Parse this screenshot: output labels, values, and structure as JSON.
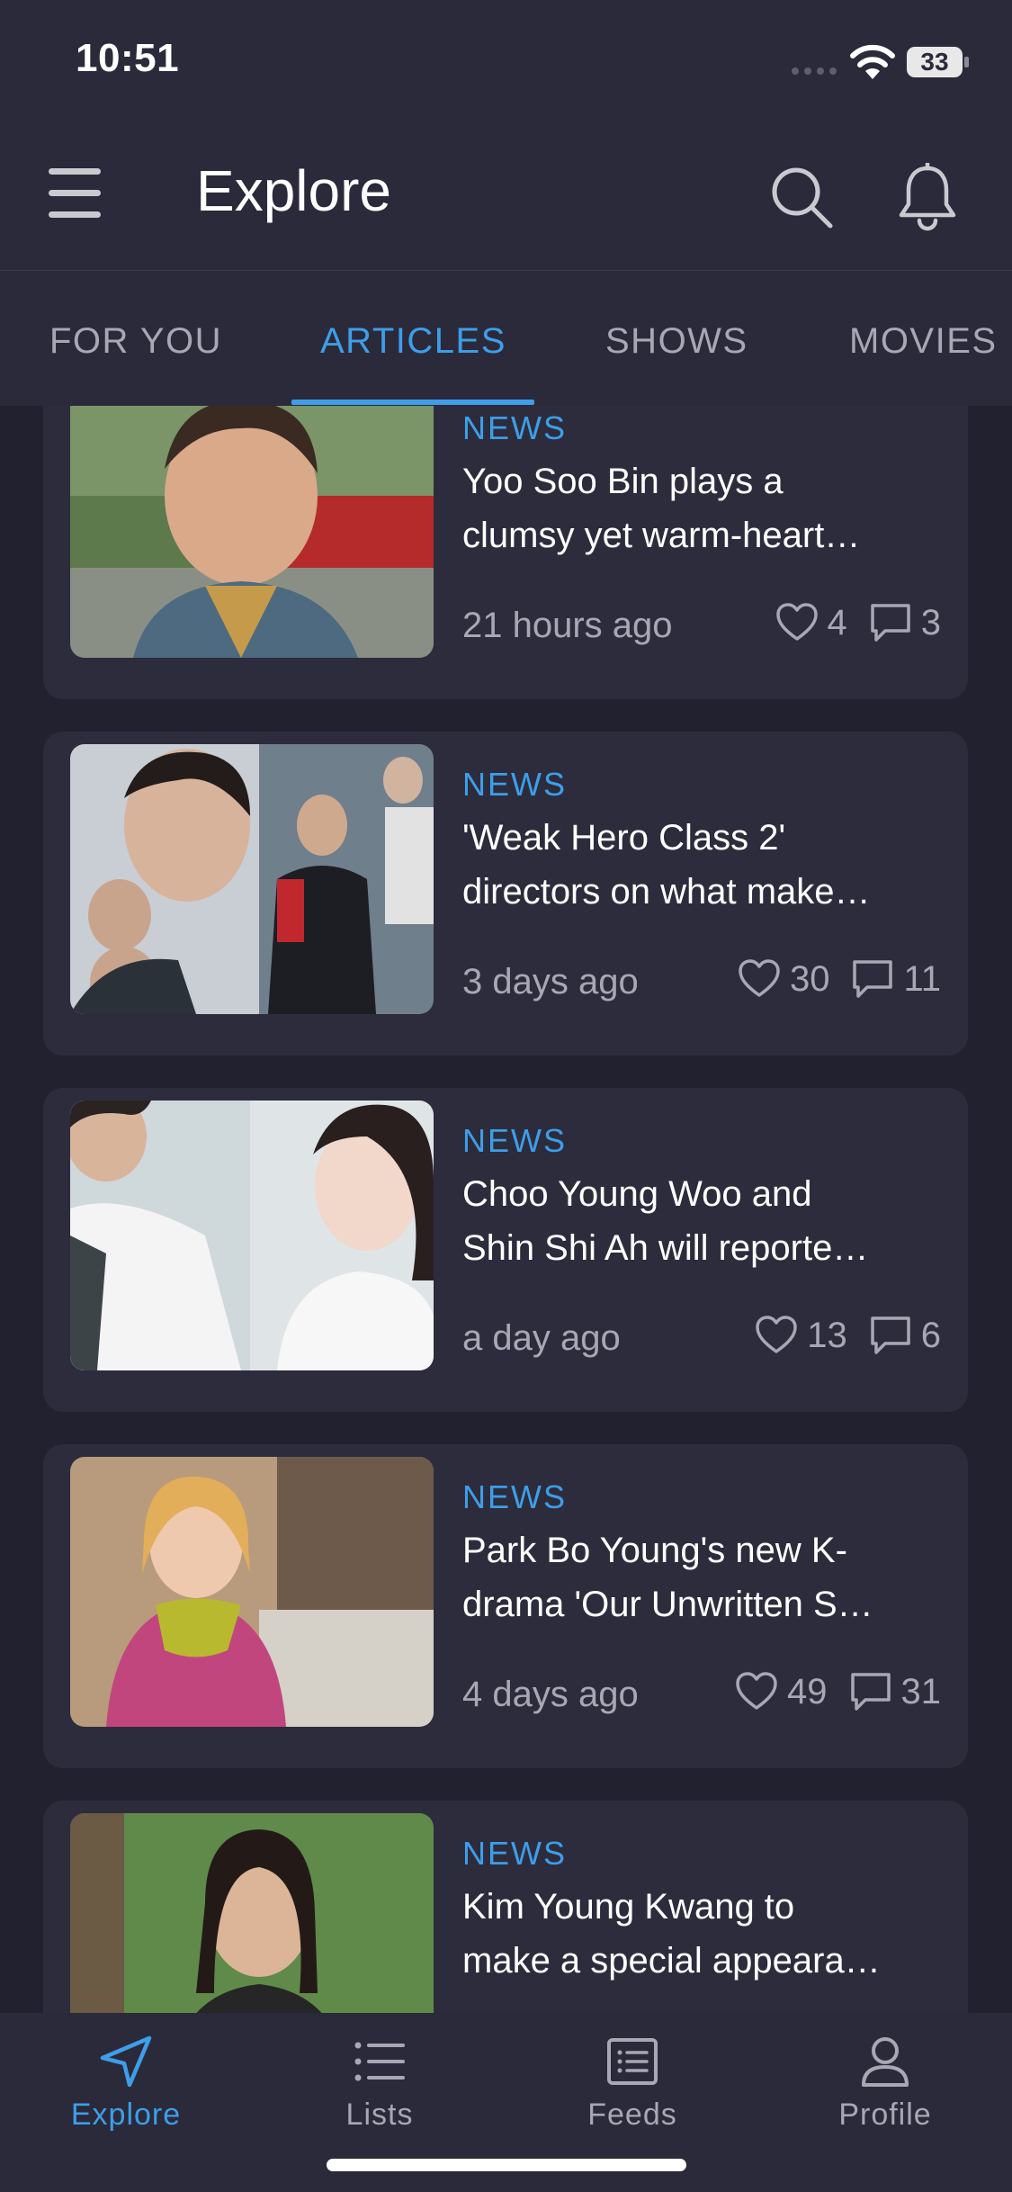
{
  "status_bar": {
    "time": "10:51",
    "battery": "33"
  },
  "header": {
    "title": "Explore"
  },
  "tabs": [
    {
      "label": "FOR YOU",
      "active": false
    },
    {
      "label": "ARTICLES",
      "active": true
    },
    {
      "label": "SHOWS",
      "active": false
    },
    {
      "label": "MOVIES",
      "active": false
    }
  ],
  "articles": [
    {
      "category": "NEWS",
      "title_line1": "Yoo Soo Bin plays a",
      "title_line2": "clumsy yet warm-heart…",
      "time": "21 hours ago",
      "likes": "4",
      "comments": "3"
    },
    {
      "category": "NEWS",
      "title_line1": "'Weak Hero Class 2'",
      "title_line2": "directors on what make…",
      "time": "3 days ago",
      "likes": "30",
      "comments": "11"
    },
    {
      "category": "NEWS",
      "title_line1": "Choo Young Woo and",
      "title_line2": "Shin Shi Ah will reporte…",
      "time": "a day ago",
      "likes": "13",
      "comments": "6"
    },
    {
      "category": "NEWS",
      "title_line1": "Park Bo Young's new K-",
      "title_line2": "drama 'Our Unwritten S…",
      "time": "4 days ago",
      "likes": "49",
      "comments": "31"
    },
    {
      "category": "NEWS",
      "title_line1": "Kim Young Kwang to",
      "title_line2": "make a special appeara…",
      "time": "",
      "likes": "",
      "comments": ""
    }
  ],
  "bottom_nav": [
    {
      "label": "Explore",
      "icon": "navigation-arrow-icon",
      "active": true
    },
    {
      "label": "Lists",
      "icon": "list-icon",
      "active": false
    },
    {
      "label": "Feeds",
      "icon": "feed-icon",
      "active": false
    },
    {
      "label": "Profile",
      "icon": "user-icon",
      "active": false
    }
  ],
  "colors": {
    "background": "#21212f",
    "surface": "#2c2c3d",
    "accent": "#3e9ee8",
    "muted_text": "#a8a8b4"
  }
}
